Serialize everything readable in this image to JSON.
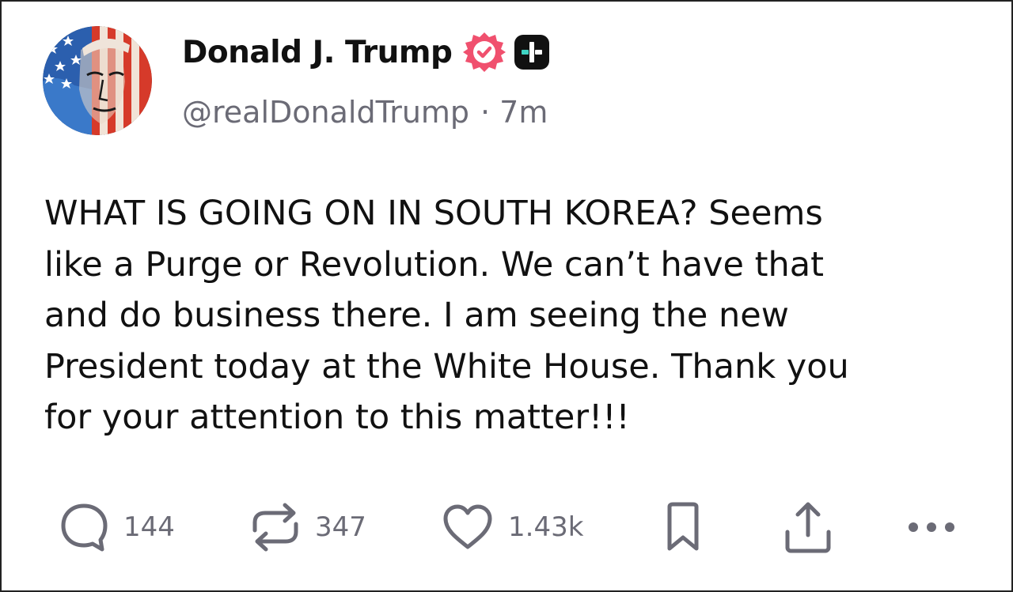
{
  "post": {
    "author": {
      "display_name": "Donald J. Trump",
      "handle": "@realDonaldTrump",
      "separator": "·",
      "time_ago": "7m"
    },
    "text_lines": [
      "WHAT IS GOING ON IN SOUTH KOREA? Seems",
      "like a Purge or Revolution. We can’t have that",
      "and do business there. I am seeing the new",
      "President today at the White House. Thank you",
      "for your attention to this matter!!!"
    ]
  },
  "actions": {
    "reply_count": "144",
    "repost_count": "347",
    "like_count": "1.43k"
  },
  "icons": {
    "verified": "verified-badge-icon",
    "plus": "plus-badge-icon",
    "reply": "reply-icon",
    "repost": "repost-icon",
    "like": "heart-icon",
    "bookmark": "bookmark-icon",
    "share": "share-icon",
    "more": "more-icon"
  },
  "colors": {
    "verified_pink": "#f0506e",
    "icon_gray": "#6b6b76",
    "text": "#111111",
    "plus_badge_bg": "#111111",
    "plus_badge_accent": "#3fd4c4"
  }
}
